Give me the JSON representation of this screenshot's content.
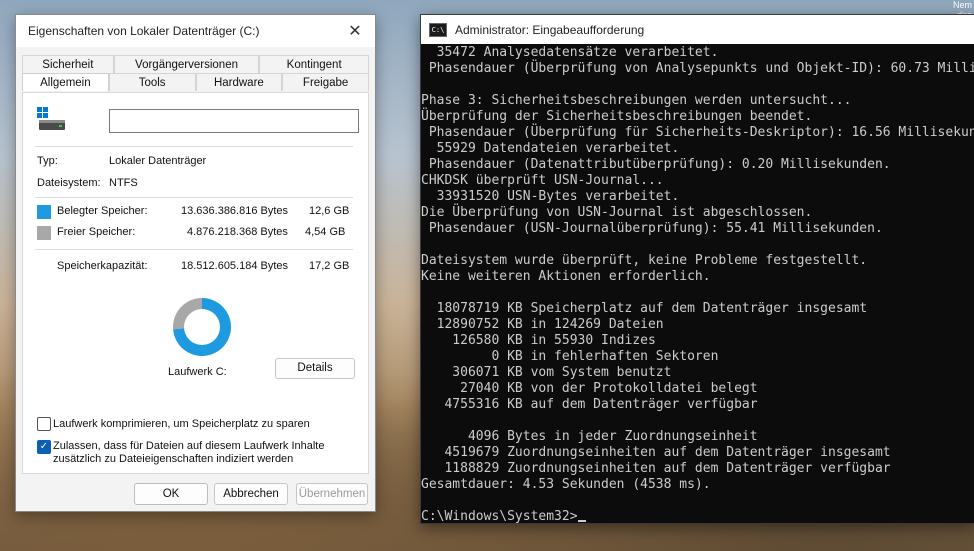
{
  "desktop": {
    "corner_text_1": "Nem",
    "corner_text_2": "dire"
  },
  "dialog": {
    "title": "Eigenschaften von Lokaler Datenträger (C:)",
    "close_glyph": "✕",
    "tabs_row1": [
      "Sicherheit",
      "Vorgängerversionen",
      "Kontingent"
    ],
    "tabs_row2": [
      "Allgemein",
      "Tools",
      "Hardware",
      "Freigabe"
    ],
    "active_tab": "Allgemein",
    "name_value": "",
    "type_label": "Typ:",
    "type_value": "Lokaler Datenträger",
    "fs_label": "Dateisystem:",
    "fs_value": "NTFS",
    "used_label": "Belegter Speicher:",
    "used_bytes": "13.636.386.816 Bytes",
    "used_size": "12,6 GB",
    "free_label": "Freier Speicher:",
    "free_bytes": "4.876.218.368 Bytes",
    "free_size": "4,54 GB",
    "capacity_label": "Speicherkapazität:",
    "capacity_bytes": "18.512.605.184 Bytes",
    "capacity_size": "17,2 GB",
    "used_fraction": 0.7366,
    "drive_label": "Laufwerk C:",
    "details_button": "Details",
    "compress_label": "Laufwerk komprimieren, um Speicherplatz zu sparen",
    "compress_checked": false,
    "index_label_1": "Zulassen, dass für Dateien auf diesem Laufwerk Inhalte",
    "index_label_2": "zusätzlich zu Dateieigenschaften indiziert werden",
    "index_checked": true,
    "ok_button": "OK",
    "cancel_button": "Abbrechen",
    "apply_button": "Übernehmen",
    "colors": {
      "used": "#1e9be0",
      "free": "#a8a8a8"
    }
  },
  "console": {
    "title": "Administrator: Eingabeaufforderung",
    "icon_text": "C:\\",
    "lines": [
      "  35472 Analysedatensätze verarbeitet.",
      " Phasendauer (Überprüfung von Analysepunkts und Objekt-ID): 60.73 Milli",
      "",
      "Phase 3: Sicherheitsbeschreibungen werden untersucht...",
      "Überprüfung der Sicherheitsbeschreibungen beendet.",
      " Phasendauer (Überprüfung für Sicherheits-Deskriptor): 16.56 Millisekun",
      "  55929 Datendateien verarbeitet.",
      " Phasendauer (Datenattributüberprüfung): 0.20 Millisekunden.",
      "CHKDSK überprüft USN-Journal...",
      "  33931520 USN-Bytes verarbeitet.",
      "Die Überprüfung von USN-Journal ist abgeschlossen.",
      " Phasendauer (USN-Journalüberprüfung): 55.41 Millisekunden.",
      "",
      "Dateisystem wurde überprüft, keine Probleme festgestellt.",
      "Keine weiteren Aktionen erforderlich.",
      "",
      "  18078719 KB Speicherplatz auf dem Datenträger insgesamt",
      "  12890752 KB in 124269 Dateien",
      "    126580 KB in 55930 Indizes",
      "         0 KB in fehlerhaften Sektoren",
      "    306071 KB vom System benutzt",
      "     27040 KB von der Protokolldatei belegt",
      "   4755316 KB auf dem Datenträger verfügbar",
      "",
      "      4096 Bytes in jeder Zuordnungseinheit",
      "   4519679 Zuordnungseinheiten auf dem Datenträger insgesamt",
      "   1188829 Zuordnungseinheiten auf dem Datenträger verfügbar",
      "Gesamtdauer: 4.53 Sekunden (4538 ms).",
      "",
      "C:\\Windows\\System32>"
    ]
  }
}
